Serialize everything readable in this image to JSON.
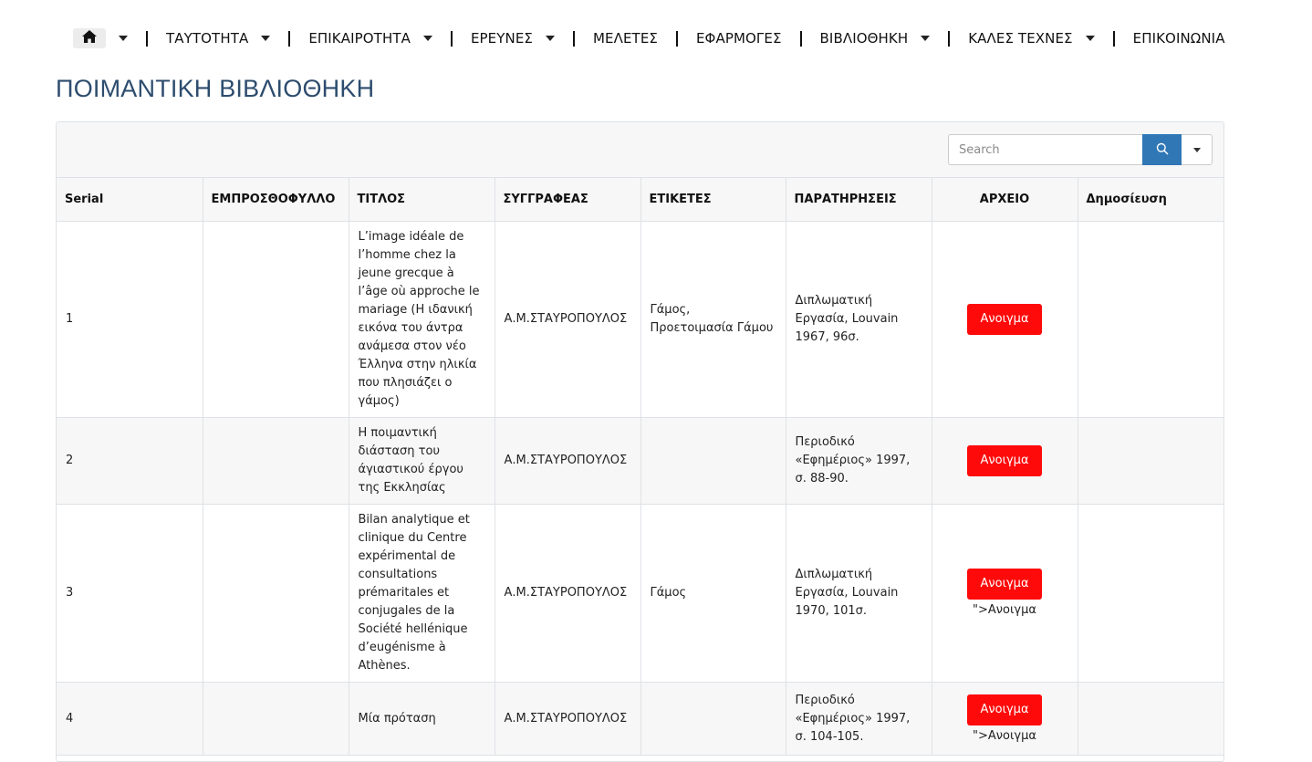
{
  "nav": {
    "home_icon": "home-icon",
    "items": [
      {
        "label": "ΤΑΥΤΟΤΗΤΑ",
        "has_dropdown": true
      },
      {
        "label": "ΕΠΙΚΑΙΡΟΤΗΤΑ",
        "has_dropdown": true
      },
      {
        "label": "ΕΡΕΥΝΕΣ",
        "has_dropdown": true
      },
      {
        "label": "ΜΕΛΕΤΕΣ",
        "has_dropdown": false
      },
      {
        "label": "ΕΦΑΡΜΟΓΕΣ",
        "has_dropdown": false
      },
      {
        "label": "ΒΙΒΛΙΟΘΗΚΗ",
        "has_dropdown": true
      },
      {
        "label": "ΚΑΛΕΣ ΤΕΧΝΕΣ",
        "has_dropdown": true
      },
      {
        "label": "ΕΠΙΚΟΙΝΩΝΙΑ",
        "has_dropdown": false
      }
    ]
  },
  "page": {
    "title": "ΠΟΙΜΑΝΤΙΚΗ ΒΙΒΛΙΟΘΗΚΗ"
  },
  "search": {
    "placeholder": "Search",
    "value": ""
  },
  "colors": {
    "title": "#2d4c6e",
    "search_button": "#3077b5",
    "open_button": "#ff0a0a"
  },
  "table": {
    "columns": [
      "Serial",
      "ΕΜΠΡΟΣΘΟΦΥΛΛΟ",
      "ΤΙΤΛΟΣ",
      "ΣΥΓΓΡΑΦΕΑΣ",
      "ΕΤΙΚΕΤΕΣ",
      "ΠΑΡΑΤΗΡΗΣΕΙΣ",
      "ΑΡΧΕΙΟ",
      "Δημοσίευση"
    ],
    "rows": [
      {
        "serial": "1",
        "cover": "",
        "title": "L’image idéale de l’homme chez la jeune grecque à l’âge où approche le mariage (Η ιδανική εικόνα του άντρα ανάμεσα στον νέο Έλληνα στην ηλικία που πλησιάζει ο γάμος)",
        "author": "Α.Μ.ΣΤΑΥΡΟΠΟΥΛΟΣ",
        "tags": "Γάμος, Προετοιμασία Γάμου",
        "notes": "Διπλωματική Εργασία, Louvain 1967, 96σ.",
        "button": "Ανοιγμα",
        "extra": "",
        "publication": ""
      },
      {
        "serial": "2",
        "cover": "",
        "title": "Η ποιμαντική διάσταση του άγιαστικού έργου της Εκκλησίας",
        "author": "Α.Μ.ΣΤΑΥΡΟΠΟΥΛΟΣ",
        "tags": "",
        "notes": "Περιοδικό «Εφημέριος» 1997, σ. 88-90.",
        "button": "Ανοιγμα",
        "extra": "",
        "publication": ""
      },
      {
        "serial": "3",
        "cover": "",
        "title": "Bilan analytique et clinique du Centre expérimental de consultations prémaritales et conjugales de la Société hellénique d’eugénisme à Athènes.",
        "author": "Α.Μ.ΣΤΑΥΡΟΠΟΥΛΟΣ",
        "tags": "Γάμος",
        "notes": "Διπλωματική Εργασία, Louvain 1970, 101σ.",
        "button": "Ανοιγμα",
        "extra": "\">Ανοιγμα",
        "publication": ""
      },
      {
        "serial": "4",
        "cover": "",
        "title": "Μία πρόταση",
        "author": "Α.Μ.ΣΤΑΥΡΟΠΟΥΛΟΣ",
        "tags": "",
        "notes": "Περιοδικό «Εφημέριος» 1997, σ. 104-105.",
        "button": "Ανοιγμα",
        "extra": "\">Ανοιγμα",
        "publication": ""
      }
    ]
  }
}
